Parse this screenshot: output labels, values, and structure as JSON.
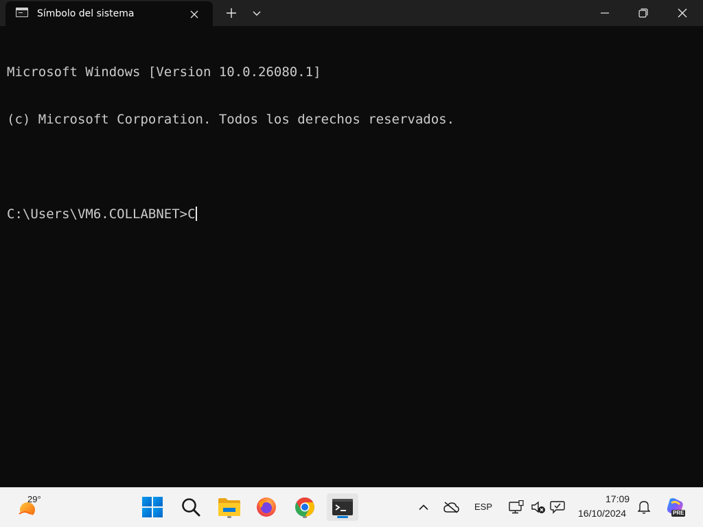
{
  "window": {
    "tab_title": "Símbolo del sistema",
    "tab_icon": "cmd-icon",
    "new_tab_icon": "plus-icon",
    "tab_menu_icon": "chevron-down-icon",
    "controls": [
      "minimize-icon",
      "restore-icon",
      "close-icon"
    ]
  },
  "console": {
    "lines": [
      "Microsoft Windows [Version 10.0.26080.1]",
      "(c) Microsoft Corporation. Todos los derechos reservados.",
      ""
    ],
    "prompt": "C:\\Users\\VM6.COLLABNET>C"
  },
  "taskbar": {
    "weather": {
      "temperature": "29°",
      "icon": "sun-icon"
    },
    "apps": [
      {
        "name": "start-button",
        "icon": "windows-logo-icon"
      },
      {
        "name": "search-button",
        "icon": "search-icon"
      },
      {
        "name": "file-explorer",
        "icon": "folder-icon",
        "active": true
      },
      {
        "name": "firefox",
        "icon": "firefox-icon"
      },
      {
        "name": "chrome",
        "icon": "chrome-icon",
        "active": true
      },
      {
        "name": "terminal",
        "icon": "terminal-icon",
        "focused": true
      }
    ],
    "tray": {
      "overflow_icon": "chevron-up-icon",
      "network_icon": "cloud-offline-icon",
      "language": "ESP",
      "system_icons": [
        "display-icon",
        "volume-muted-icon",
        "chat-icon"
      ],
      "time": "17:09",
      "date": "16/10/2024",
      "notification_icon": "bell-icon",
      "copilot_badge": "PRE"
    }
  },
  "colors": {
    "console_bg": "#0c0c0c",
    "titlebar_bg": "#202020",
    "console_text": "#cccccc",
    "taskbar_bg": "#f3f3f3",
    "accent": "#0078d4"
  }
}
